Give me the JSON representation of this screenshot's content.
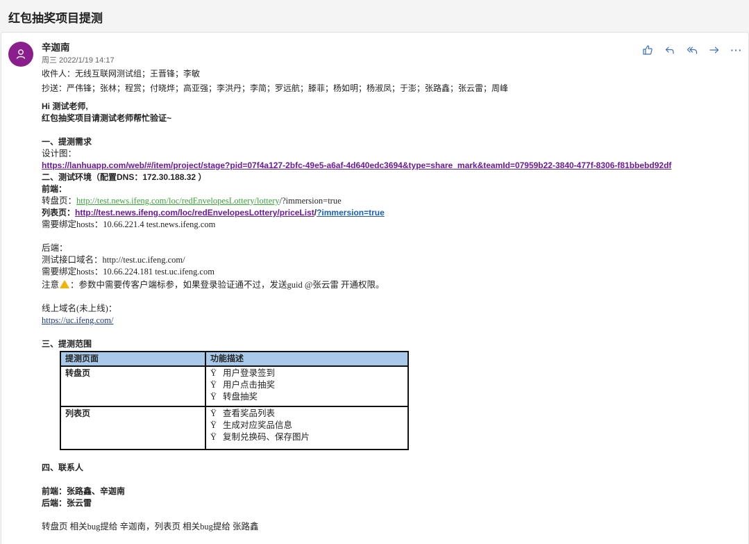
{
  "subject": "红包抽奖项目提测",
  "sender": {
    "name": "辛迦南",
    "date": "周三 2022/1/19 14:17",
    "to": "收件人：无线互联网测试组；王晋锋；李敏",
    "cc": "抄送：严伟锋；张林；程赏；付晓烨；高亚强；李洪丹；李简；罗远航；滕菲；杨如明；杨淑凤；于澎；张路鑫；张云雷；周峰",
    "avatar_icon": "person-icon",
    "avatar_color": "#8a1e8c"
  },
  "actions": {
    "like": "like-icon",
    "reply": "reply-icon",
    "reply_all": "reply-all-icon",
    "forward": "forward-icon",
    "more": "···"
  },
  "body": {
    "greeting": "Hi 测试老师,",
    "intro": "红包抽奖项目请测试老师帮忙验证~",
    "s1_title": "一、提测需求",
    "design_label": "设计图：",
    "design_url": "https://lanhuapp.com/web/#/item/project/stage?pid=07f4a127-2bfc-49e5-a6af-4d640edc3694&type=share_mark&teamId=07959b22-3840-477f-8306-f81bbebd92df",
    "s2_title": "二、测试环境（配置DNS：172.30.188.32 ）",
    "frontend_label": "前端：",
    "turntable_label": "转盘页：",
    "turntable_url": "http://test.news.ifeng.com/loc/redEnvelopesLottery/lottery",
    "turntable_query": "/?immersion=true",
    "list_label": "列表页：",
    "list_url": "http://test.news.ifeng.com/loc/redEnvelopesLottery/priceList",
    "list_sep": "/",
    "list_query": "?immersion=true",
    "hosts1": "需要绑定hosts：10.66.221.4 test.news.ifeng.com",
    "backend_label": "后端：",
    "api_domain": "测试接口域名：http://test.uc.ifeng.com/",
    "hosts2": "需要绑定hosts：10.66.224.181 test.uc.ifeng.com",
    "note_prefix": "注意",
    "note_text": "：参数中需要传客户端标参，如果登录验证通不过，发送guid @张云雷 开通权限。",
    "online_label": "线上域名(未上线)：",
    "online_url": "https://uc.ifeng.com/",
    "s3_title": "三、提测范围",
    "table": {
      "headers": [
        "提测页面",
        "功能描述"
      ],
      "rows": [
        {
          "page": "转盘页",
          "items": [
            "用户登录签到",
            "用户点击抽奖",
            "转盘抽奖"
          ]
        },
        {
          "page": "列表页",
          "items": [
            "查看奖品列表",
            "生成对应奖品信息",
            "复制兑换码、保存图片"
          ]
        }
      ],
      "bullet": "Ÿ"
    },
    "s4_title": "四、联系人",
    "frontend_contacts": "前端：张路鑫、辛迦南",
    "backend_contacts": "后端：张云雷",
    "bug_note": "转盘页 相关bug提给 辛迦南，列表页 相关bug提给 张路鑫"
  },
  "colors": {
    "table_header": "#a9c9ea",
    "link_purple": "#6a1a9a",
    "link_green": "#3aa43a",
    "accent": "#4a6fb5"
  }
}
